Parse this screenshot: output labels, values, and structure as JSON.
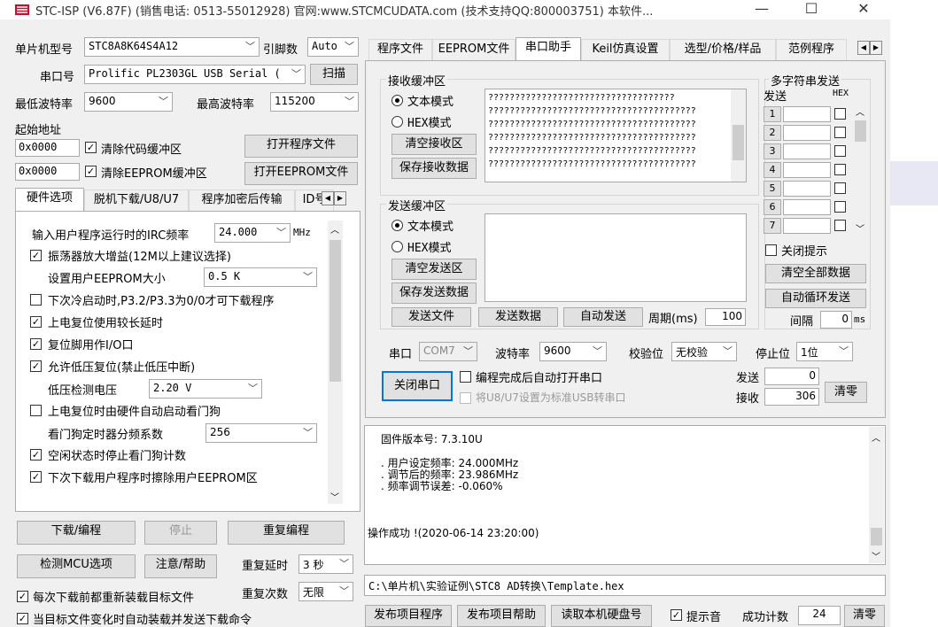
{
  "title": "STC-ISP (V6.87F) (销售电话: 0513-55012928) 官网:www.STCMCUDATA.com  (技术支持QQ:800003751) 本软件...",
  "win": {
    "min": "—",
    "max": "☐",
    "close": "✕"
  },
  "left": {
    "mcu_label": "单片机型号",
    "mcu_value": "STC8A8K64S4A12",
    "pins_label": "引脚数",
    "pins_value": "Auto",
    "port_label": "串口号",
    "port_value": "Prolific PL2303GL USB Serial (",
    "scan": "扫描",
    "min_baud_label": "最低波特率",
    "min_baud": "9600",
    "max_baud_label": "最高波特率",
    "max_baud": "115200",
    "start_addr_label": "起始地址",
    "addr1": "0x0000",
    "clear_code": "清除代码缓冲区",
    "open_prog": "打开程序文件",
    "addr2": "0x0000",
    "clear_eeprom": "清除EEPROM缓冲区",
    "open_eeprom": "打开EEPROM文件",
    "tabs": [
      "硬件选项",
      "脱机下载/U8/U7",
      "程序加密后传输",
      "ID号"
    ],
    "hw": {
      "irc_label": "输入用户程序运行时的IRC频率",
      "irc_value": "24.000",
      "irc_unit": "MHz",
      "osc_gain": "振荡器放大增益(12M以上建议选择)",
      "eeprom_size_label": "设置用户EEPROM大小",
      "eeprom_size": "0.5 K",
      "cold_boot": "下次冷启动时,P3.2/P3.3为0/0才可下载程序",
      "por_delay": "上电复位使用较长延时",
      "reset_io": "复位脚用作I/O口",
      "lvr": "允许低压复位(禁止低压中断)",
      "lv_label": "低压检测电压",
      "lv_value": "2.20 V",
      "wdt_hw": "上电复位时由硬件自动启动看门狗",
      "wdt_div_label": "看门狗定时器分频系数",
      "wdt_div": "256",
      "wdt_idle": "空闲状态时停止看门狗计数",
      "erase_eeprom": "下次下载用户程序时擦除用户EEPROM区"
    },
    "download": "下载/编程",
    "stop": "停止",
    "reprogram": "重复编程",
    "detect": "检测MCU选项",
    "help": "注意/帮助",
    "repeat_delay_label": "重复延时",
    "repeat_delay": "3 秒",
    "repeat_count_label": "重复次数",
    "repeat_count": "无限",
    "reload_each": "每次下载前都重新装载目标文件",
    "auto_reload": "当目标文件变化时自动装载并发送下载命令"
  },
  "right": {
    "tabs": [
      "程序文件",
      "EEPROM文件",
      "串口助手",
      "Keil仿真设置",
      "选型/价格/样品",
      "范例程序"
    ],
    "recv_group": "接收缓冲区",
    "text_mode": "文本模式",
    "hex_mode": "HEX模式",
    "clear_recv": "清空接收区",
    "save_recv": "保存接收数据",
    "recv_lines": [
      "    ???????????????????????????????????",
      "???????????????????????????????????????",
      "???????????????????????????????????????",
      "???????????????????????????????????????",
      "???????????????????????????????????????",
      "???????????????????????????????????????"
    ],
    "send_group": "发送缓冲区",
    "clear_send": "清空发送区",
    "save_send": "保存发送数据",
    "send_file": "发送文件",
    "send_data": "发送数据",
    "auto_send": "自动发送",
    "period_label": "周期(ms)",
    "period": "100",
    "multi_title": "多字符串发送",
    "multi_send": "发送",
    "multi_hex": "HEX",
    "multi_rows": [
      "1",
      "2",
      "3",
      "4",
      "5",
      "6",
      "7"
    ],
    "close_hint": "关闭提示",
    "clear_all": "清空全部数据",
    "auto_cycle": "自动循环发送",
    "interval_label": "间隔",
    "interval": "0",
    "interval_unit": "ms",
    "port_label": "串口",
    "port": "COM7",
    "baud_label": "波特率",
    "baud": "9600",
    "parity_label": "校验位",
    "parity": "无校验",
    "stop_label": "停止位",
    "stop": "1位",
    "close_port": "关闭串口",
    "auto_open": "编程完成后自动打开串口",
    "usb_std": "将U8/U7设置为标准USB转串口",
    "sent_label": "发送",
    "sent": "0",
    "recv_label": "接收",
    "recv": "306",
    "clear": "清零"
  },
  "log": {
    "fw": "固件版本号: 7.3.10U",
    "l1": "用户设定频率: 24.000MHz",
    "l2": "调节后的频率: 23.986MHz",
    "l3": "频率调节误差: -0.060%",
    "ok": "操作成功 !(2020-06-14 23:20:00)"
  },
  "path": "C:\\单片机\\实验证例\\STC8 AD转换\\Template.hex",
  "bottom": {
    "publish": "发布项目程序",
    "publish_help": "发布项目帮助",
    "read_hdd": "读取本机硬盘号",
    "sound": "提示音",
    "success_label": "成功计数",
    "success": "24",
    "clear": "清零"
  },
  "colors": {
    "accent": "#0078d7",
    "title_icon": "#c8102e"
  }
}
